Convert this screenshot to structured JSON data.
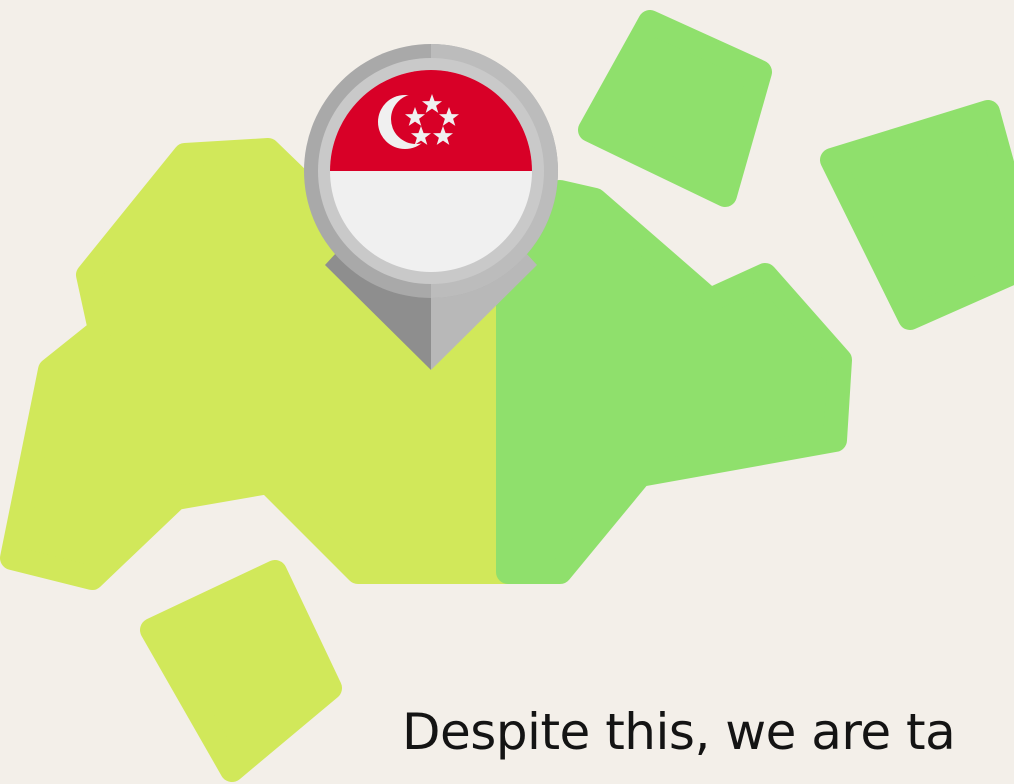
{
  "slide": {
    "caption": "Despite this, we are ta"
  },
  "illustration": {
    "map_pin_icon": "map-pin-icon",
    "flag_icon": "singapore-flag-icon",
    "colors": {
      "background": "#f3efe9",
      "land_left": "#d1e85a",
      "land_right": "#8fe06c",
      "flag_red": "#d80027",
      "flag_white": "#f0f0f0",
      "pin_ring": "#a9a9a9",
      "pin_dark": "#8e8e8e",
      "text": "#141414"
    }
  }
}
